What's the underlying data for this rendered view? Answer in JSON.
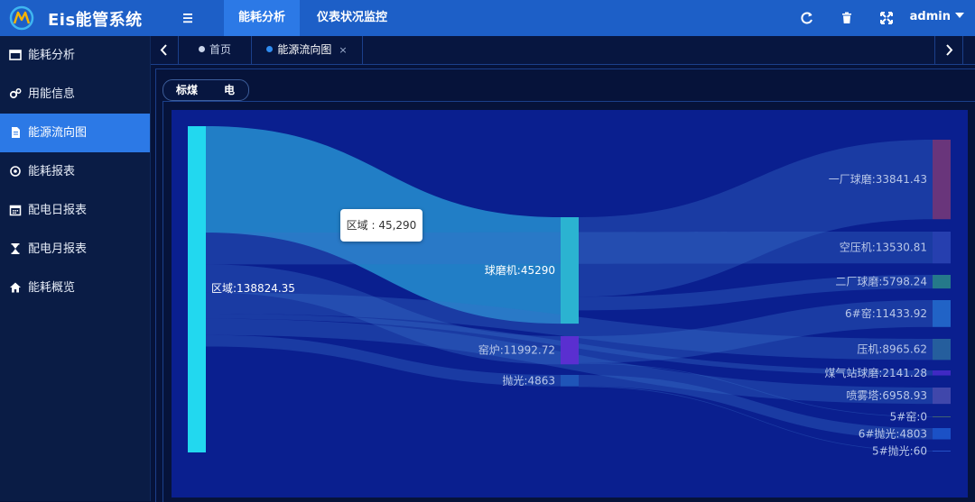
{
  "header": {
    "app_title": "Eis能管系统",
    "nav": [
      {
        "label": "能耗分析",
        "active": true
      },
      {
        "label": "仪表状况监控",
        "active": false
      }
    ],
    "user": "admin",
    "icons": [
      "refresh-icon",
      "trash-icon",
      "fullscreen-icon"
    ]
  },
  "sidebar": {
    "items": [
      {
        "label": "能耗分析",
        "icon": "window-icon",
        "active": false
      },
      {
        "label": "用能信息",
        "icon": "gears-icon",
        "active": false
      },
      {
        "label": "能源流向图",
        "icon": "file-icon",
        "active": true
      },
      {
        "label": "能耗报表",
        "icon": "target-icon",
        "active": false
      },
      {
        "label": "配电日报表",
        "icon": "calendar-icon",
        "active": false
      },
      {
        "label": "配电月报表",
        "icon": "hourglass-icon",
        "active": false
      },
      {
        "label": "能耗概览",
        "icon": "home-icon",
        "active": false
      }
    ]
  },
  "tabs": [
    {
      "label": "首页",
      "active": false,
      "dot_color": "#c9d4ea"
    },
    {
      "label": "能源流向图",
      "active": true,
      "dot_color": "#2f8cf0",
      "close": "×"
    }
  ],
  "energy_tabs": [
    "标煤",
    "电"
  ],
  "tooltip": {
    "text": "区域 : 45,290"
  },
  "chart_data": {
    "type": "sankey",
    "nodes": [
      {
        "name": "区域",
        "value": 138824.35,
        "label": "区域:138824.35",
        "color": "#22d8ef"
      },
      {
        "name": "球磨机",
        "value": 45290,
        "label": "球磨机:45290",
        "color": "#2bb3d1"
      },
      {
        "name": "窑炉",
        "value": 11992.72,
        "label": "窑炉:11992.72",
        "color": "#5a2fd0"
      },
      {
        "name": "抛光",
        "value": 4863,
        "label": "抛光:4863",
        "color": "#1f55b8"
      },
      {
        "name": "一厂球磨",
        "value": 33841.43,
        "label": "一厂球磨:33841.43",
        "color": "#7a3a78"
      },
      {
        "name": "空压机",
        "value": 13530.81,
        "label": "空压机:13530.81",
        "color": "#2b45b5"
      },
      {
        "name": "二厂球磨",
        "value": 5798.24,
        "label": "二厂球磨:5798.24",
        "color": "#2a8a8a"
      },
      {
        "name": "6#窑",
        "value": 11433.92,
        "label": "6#窑:11433.92",
        "color": "#2670d0"
      },
      {
        "name": "压机",
        "value": 8965.62,
        "label": "压机:8965.62",
        "color": "#2a6aa0"
      },
      {
        "name": "煤气站球磨",
        "value": 2141.28,
        "label": "煤气站球磨:2141.28",
        "color": "#4a2bcc"
      },
      {
        "name": "喷雾塔",
        "value": 6958.93,
        "label": "喷雾塔:6958.93",
        "color": "#4a4fb0"
      },
      {
        "name": "5#窑",
        "value": 0,
        "label": "5#窑:0",
        "color": "#4a6f6f"
      },
      {
        "name": "6#抛光",
        "value": 4803,
        "label": "6#抛光:4803",
        "color": "#1f5ad0"
      },
      {
        "name": "5#抛光",
        "value": 60,
        "label": "5#抛光:60",
        "color": "#2a5ad0"
      }
    ],
    "links": [
      {
        "source": "区域",
        "target": "球磨机",
        "value": 45290
      },
      {
        "source": "区域",
        "target": "空压机",
        "value": 13530.81
      },
      {
        "source": "区域",
        "target": "窑炉",
        "value": 11992.72
      },
      {
        "source": "区域",
        "target": "压机",
        "value": 8965.62
      },
      {
        "source": "区域",
        "target": "煤气站球磨",
        "value": 2141.28
      },
      {
        "source": "区域",
        "target": "喷雾塔",
        "value": 6958.93
      },
      {
        "source": "区域",
        "target": "抛光",
        "value": 4863
      },
      {
        "source": "球磨机",
        "target": "一厂球磨",
        "value": 33841.43
      },
      {
        "source": "球磨机",
        "target": "二厂球磨",
        "value": 5798.24
      },
      {
        "source": "窑炉",
        "target": "6#窑",
        "value": 11433.92
      },
      {
        "source": "窑炉",
        "target": "5#窑",
        "value": 0
      },
      {
        "source": "抛光",
        "target": "6#抛光",
        "value": 4803
      },
      {
        "source": "抛光",
        "target": "5#抛光",
        "value": 60
      }
    ]
  }
}
